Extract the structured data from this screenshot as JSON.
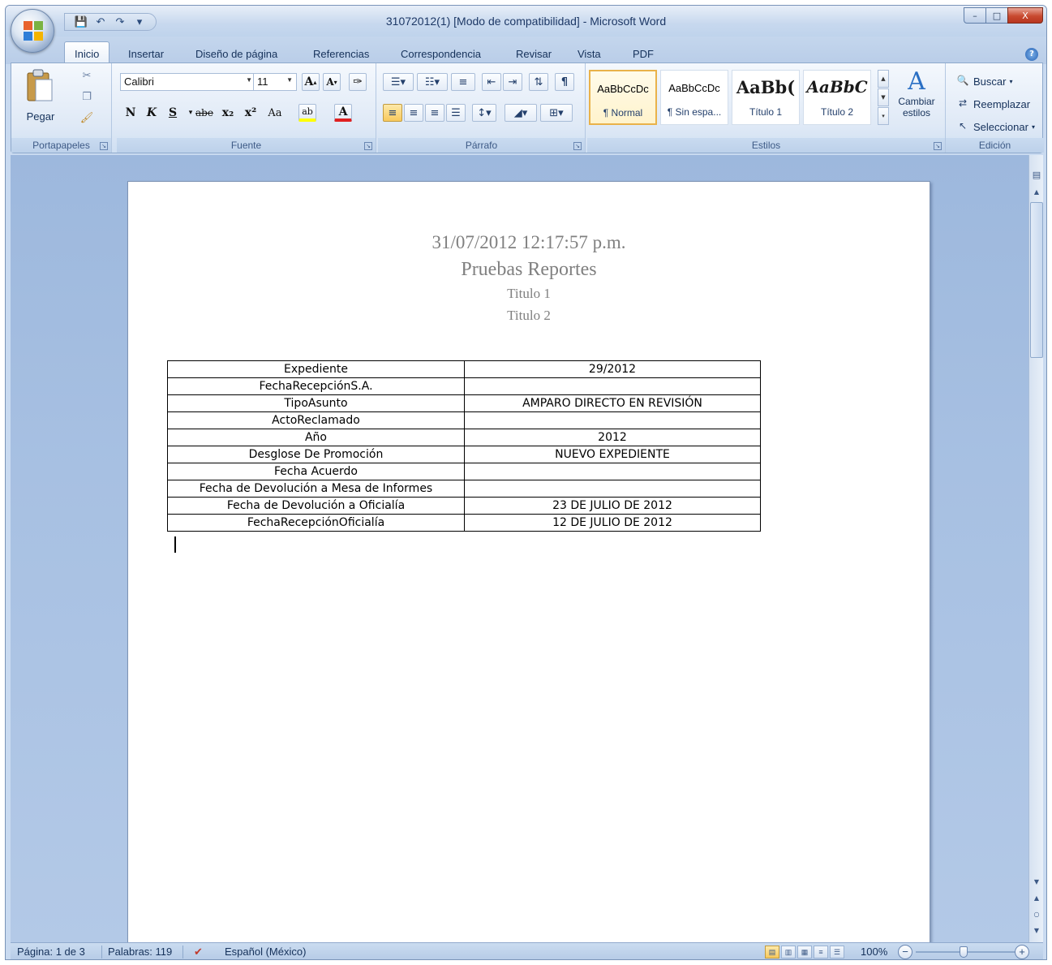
{
  "window": {
    "title": "31072012(1) [Modo de compatibilidad] - Microsoft Word",
    "controls": {
      "minimize": "–",
      "maximize": "□",
      "close": "X"
    }
  },
  "quick_access": {
    "save_icon": "save-icon",
    "undo_icon": "undo-icon",
    "redo_icon": "redo-icon"
  },
  "tabs": [
    "Inicio",
    "Insertar",
    "Diseño de página",
    "Referencias",
    "Correspondencia",
    "Revisar",
    "Vista",
    "PDF"
  ],
  "ribbon": {
    "clipboard": {
      "label": "Portapapeles",
      "paste": "Pegar"
    },
    "font": {
      "label": "Fuente",
      "family": "Calibri",
      "size": "11",
      "bold": "N",
      "italic": "K",
      "underline": "S",
      "strike": "abe",
      "subscript": "x₂",
      "superscript": "x²",
      "case": "Aa",
      "highlight": "ab",
      "font_color": "A",
      "grow": "A",
      "shrink": "A"
    },
    "paragraph": {
      "label": "Párrafo"
    },
    "styles": {
      "label": "Estilos",
      "items": [
        {
          "sample": "AaBbCcDc",
          "name": "¶ Normal"
        },
        {
          "sample": "AaBbCcDc",
          "name": "¶ Sin espa..."
        },
        {
          "sample": "AaBb(",
          "name": "Título 1"
        },
        {
          "sample": "AaBbC",
          "name": "Título 2"
        }
      ],
      "change": "Cambiar estilos"
    },
    "editing": {
      "label": "Edición",
      "find": "Buscar",
      "replace": "Reemplazar",
      "select": "Seleccionar"
    }
  },
  "document": {
    "datetime": "31/07/2012 12:17:57 p.m.",
    "title": "Pruebas Reportes",
    "subtitle1": "Titulo 1",
    "subtitle2": "Titulo 2",
    "table": [
      [
        "Expediente",
        "29/2012"
      ],
      [
        "FechaRecepciónS.A.",
        ""
      ],
      [
        "TipoAsunto",
        "AMPARO DIRECTO EN REVISIÓN"
      ],
      [
        "ActoReclamado",
        ""
      ],
      [
        "Año",
        "2012"
      ],
      [
        "Desglose De Promoción",
        "NUEVO EXPEDIENTE"
      ],
      [
        "Fecha Acuerdo",
        ""
      ],
      [
        "Fecha de Devolución a Mesa de Informes",
        ""
      ],
      [
        "Fecha de Devolución a Oficialía",
        "23 DE JULIO DE 2012"
      ],
      [
        "FechaRecepciónOficialía",
        "12 DE JULIO DE 2012"
      ]
    ]
  },
  "statusbar": {
    "page": "Página: 1 de 3",
    "words": "Palabras: 119",
    "language": "Español (México)",
    "zoom": "100%"
  }
}
